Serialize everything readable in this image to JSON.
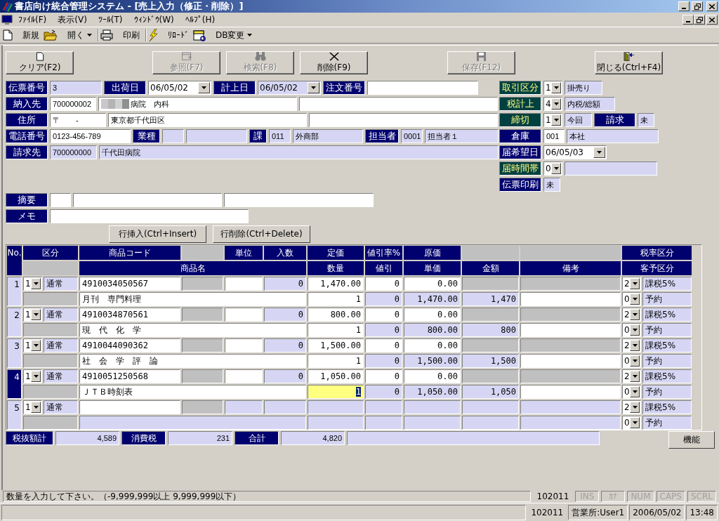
{
  "window": {
    "title": "書店向け統合管理システム - [売上入力（修正・削除）]"
  },
  "menu": [
    {
      "label": "ﾌｧｲﾙ(F)"
    },
    {
      "label": "表示(V)"
    },
    {
      "label": "ﾂｰﾙ(T)"
    },
    {
      "label": "ｳｨﾝﾄﾞｳ(W)"
    },
    {
      "label": "ﾍﾙﾌﾟ(H)"
    }
  ],
  "toolbar": [
    [
      {
        "label": "新規",
        "dropdown": false
      },
      {
        "label": "開く",
        "dropdown": true
      }
    ],
    [
      {
        "label": "印刷",
        "dropdown": false
      }
    ],
    [
      {
        "label": "ﾘﾛｰﾄﾞ",
        "dropdown": false
      },
      {
        "label": "DB変更",
        "dropdown": true
      }
    ]
  ],
  "actions": [
    {
      "label": "クリア(F2)",
      "disabled": false
    },
    {
      "label": "参照(F7)",
      "disabled": true
    },
    {
      "label": "検索(F8)",
      "disabled": true
    },
    {
      "label": "削除(F9)",
      "disabled": false
    },
    {
      "label": "保存(F12)",
      "disabled": true
    },
    {
      "label": "閉じる(Ctrl+F4)",
      "disabled": false
    }
  ],
  "header": {
    "left": [
      {
        "cells": [
          {
            "kind": "label",
            "text": "伝票番号",
            "accent": false
          },
          {
            "kind": "field",
            "text": "3",
            "readonly": true
          },
          {
            "kind": "label",
            "text": "出荷日",
            "accent": false
          },
          {
            "kind": "combo",
            "text": "06/05/02",
            "readonly": false
          },
          {
            "kind": "label",
            "text": "計上日",
            "accent": false
          },
          {
            "kind": "combo",
            "text": "06/05/02",
            "readonly": true
          },
          {
            "kind": "label",
            "text": "注文番号",
            "accent": false
          },
          {
            "kind": "field",
            "readonly": false
          }
        ]
      },
      {
        "cells": [
          {
            "kind": "label",
            "text": "納入先",
            "accent": false
          },
          {
            "kind": "field",
            "text": "700000002",
            "readonly": false
          },
          {
            "kind": "field",
            "text": "病院　内科",
            "readonly": false,
            "redacted": true
          },
          {
            "kind": "field",
            "readonly": false
          }
        ]
      },
      {
        "cells": [
          {
            "kind": "label",
            "text": "住所",
            "accent": false
          },
          {
            "kind": "field",
            "text": "〒　　-",
            "readonly": false
          },
          {
            "kind": "field",
            "text": "東京都千代田区",
            "readonly": false
          },
          {
            "kind": "field",
            "readonly": false
          }
        ]
      },
      {
        "cells": [
          {
            "kind": "label",
            "text": "電話番号",
            "accent": false
          },
          {
            "kind": "field",
            "text": "0123-456-789",
            "readonly": false
          },
          {
            "kind": "label",
            "text": "業種",
            "accent": false
          },
          {
            "kind": "field",
            "readonly": true
          },
          {
            "kind": "field",
            "readonly": true
          },
          {
            "kind": "label",
            "text": "課",
            "accent": false
          },
          {
            "kind": "field",
            "text": "011",
            "readonly": true
          },
          {
            "kind": "field",
            "text": "外商部",
            "readonly": true
          },
          {
            "kind": "label",
            "text": "担当者",
            "accent": false
          },
          {
            "kind": "field",
            "text": "0001",
            "readonly": true
          },
          {
            "kind": "field",
            "text": "担当者１",
            "readonly": true
          }
        ]
      },
      {
        "cells": [
          {
            "kind": "label",
            "text": "請求先",
            "accent": false
          },
          {
            "kind": "field",
            "text": "700000000",
            "readonly": true
          },
          {
            "kind": "field",
            "text": "千代田病院",
            "readonly": true
          }
        ]
      }
    ],
    "right": [
      {
        "cells": [
          {
            "kind": "label",
            "text": "取引区分",
            "accent": true
          },
          {
            "kind": "combo",
            "text": "1",
            "readonly": false
          },
          {
            "kind": "field",
            "text": "掛売り",
            "readonly": true
          }
        ]
      },
      {
        "cells": [
          {
            "kind": "label",
            "text": "税計上",
            "accent": true
          },
          {
            "kind": "combo",
            "text": "4",
            "readonly": false
          },
          {
            "kind": "field",
            "text": "内税/総額",
            "readonly": true
          }
        ]
      },
      {
        "cells": [
          {
            "kind": "label",
            "text": "締切",
            "accent": true
          },
          {
            "kind": "combo",
            "text": "1",
            "readonly": false
          },
          {
            "kind": "field",
            "text": "今回",
            "readonly": true
          },
          {
            "kind": "label",
            "text": "請求",
            "accent": false
          },
          {
            "kind": "field",
            "text": "未",
            "readonly": true
          }
        ]
      },
      {
        "cells": [
          {
            "kind": "label",
            "text": "倉庫",
            "accent": false
          },
          {
            "kind": "field",
            "text": "001",
            "readonly": false
          },
          {
            "kind": "field",
            "text": "本社",
            "readonly": true
          }
        ]
      },
      {
        "cells": [
          {
            "kind": "label",
            "text": "届希望日",
            "accent": false
          },
          {
            "kind": "combo",
            "text": "06/05/03",
            "readonly": false
          }
        ]
      },
      {
        "cells": [
          {
            "kind": "label",
            "text": "届時間帯",
            "accent": true
          },
          {
            "kind": "combo",
            "text": "0",
            "readonly": false
          },
          {
            "kind": "field",
            "readonly": true
          }
        ]
      },
      {
        "cells": [
          {
            "kind": "label",
            "text": "伝票印刷",
            "accent": false
          },
          {
            "kind": "field",
            "text": "未",
            "readonly": true
          }
        ]
      }
    ],
    "notes": [
      {
        "cells": [
          {
            "kind": "label",
            "text": "摘要",
            "accent": false
          },
          {
            "kind": "field",
            "readonly": false
          },
          {
            "kind": "field",
            "readonly": false
          },
          {
            "kind": "field",
            "readonly": false
          }
        ]
      },
      {
        "cells": [
          {
            "kind": "label",
            "text": "メモ",
            "accent": false
          },
          {
            "kind": "field",
            "readonly": false
          }
        ]
      }
    ]
  },
  "row_buttons": [
    {
      "label": "行挿入(Ctrl+Insert)"
    },
    {
      "label": "行削除(Ctrl+Delete)"
    }
  ],
  "table": {
    "header_top": [
      {
        "kind": "heading",
        "text": "No."
      },
      {
        "kind": "heading",
        "text": "区分"
      },
      {
        "kind": "heading",
        "text": "商品コード"
      },
      {
        "kind": "blank"
      },
      {
        "kind": "heading",
        "text": "単位"
      },
      {
        "kind": "heading",
        "text": "入数"
      },
      {
        "kind": "heading",
        "text": "定価"
      },
      {
        "kind": "heading",
        "text": "値引率%"
      },
      {
        "kind": "heading",
        "text": "原価"
      },
      {
        "kind": "blank"
      },
      {
        "kind": "blank"
      },
      {
        "kind": "heading",
        "text": "税率区分"
      }
    ],
    "header_bottom": [
      {
        "kind": "blank"
      },
      {
        "kind": "heading",
        "text": "商品名"
      },
      {
        "kind": "heading",
        "text": "数量"
      },
      {
        "kind": "heading",
        "text": "値引"
      },
      {
        "kind": "heading",
        "text": "単価"
      },
      {
        "kind": "heading",
        "text": "金額"
      },
      {
        "kind": "heading",
        "text": "備考"
      },
      {
        "kind": "heading",
        "text": "客予区分"
      }
    ],
    "items": [
      {
        "no": "1",
        "selected": false,
        "blank": false,
        "qty_focused": false,
        "kubun_code": "1",
        "kubun": "通常",
        "code": "4910034050567",
        "irisu": "0",
        "teika": "1,470.00",
        "nebiki_rate": "0",
        "genka": "0.00",
        "tax_code": "2",
        "tax": "課税5%",
        "name": "月刊　専門料理",
        "qty": "1",
        "nebiki": "0",
        "tanka": "1,470.00",
        "kingaku": "1,470",
        "kyaku_code": "0",
        "kyaku": "予約"
      },
      {
        "no": "2",
        "selected": false,
        "blank": false,
        "qty_focused": false,
        "kubun_code": "1",
        "kubun": "通常",
        "code": "4910034870561",
        "irisu": "0",
        "teika": "800.00",
        "nebiki_rate": "0",
        "genka": "0.00",
        "tax_code": "2",
        "tax": "課税5%",
        "name": "現　代　化　学",
        "qty": "1",
        "nebiki": "0",
        "tanka": "800.00",
        "kingaku": "800",
        "kyaku_code": "0",
        "kyaku": "予約"
      },
      {
        "no": "3",
        "selected": false,
        "blank": false,
        "qty_focused": false,
        "kubun_code": "1",
        "kubun": "通常",
        "code": "4910044090362",
        "irisu": "0",
        "teika": "1,500.00",
        "nebiki_rate": "0",
        "genka": "0.00",
        "tax_code": "2",
        "tax": "課税5%",
        "name": "社　会　学　評　論",
        "qty": "1",
        "nebiki": "0",
        "tanka": "1,500.00",
        "kingaku": "1,500",
        "kyaku_code": "0",
        "kyaku": "予約"
      },
      {
        "no": "4",
        "selected": true,
        "blank": false,
        "qty_focused": true,
        "kubun_code": "1",
        "kubun": "通常",
        "code": "4910051250568",
        "irisu": "0",
        "teika": "1,050.00",
        "nebiki_rate": "0",
        "genka": "0.00",
        "tax_code": "2",
        "tax": "課税5%",
        "name": "ＪＴＢ時刻表",
        "qty": "1",
        "nebiki": "0",
        "tanka": "1,050.00",
        "kingaku": "1,050",
        "kyaku_code": "0",
        "kyaku": "予約"
      },
      {
        "no": "5",
        "selected": false,
        "blank": true,
        "qty_focused": false,
        "kubun_code": "1",
        "kubun": "通常",
        "tax_code": "2",
        "tax": "課税5%",
        "kyaku_code": "0",
        "kyaku": "予約"
      }
    ]
  },
  "totals": [
    {
      "label": "税抜額計",
      "value": "4,589"
    },
    {
      "label": "消費税",
      "value": "231"
    },
    {
      "label": "合計",
      "value": "4,820"
    }
  ],
  "function_button": {
    "label": "機能"
  },
  "status": {
    "message": "数量を入力して下さい。（-9,999,999以上 9,999,999以下）",
    "code": "102011",
    "indicators": [
      {
        "label": "INS",
        "on": false
      },
      {
        "label": "ｶﾅ",
        "on": false
      },
      {
        "label": "NUM",
        "on": false
      },
      {
        "label": "CAPS",
        "on": false
      },
      {
        "label": "SCRL",
        "on": false
      }
    ]
  },
  "status_bar": [
    {
      "text": "102011",
      "framed": false
    },
    {
      "text": "営業所:User1",
      "framed": true
    },
    {
      "text": "2006/05/02",
      "framed": true
    },
    {
      "text": "13:48",
      "framed": true
    }
  ]
}
